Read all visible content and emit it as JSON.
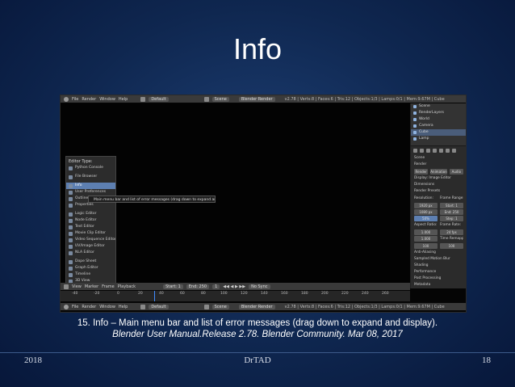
{
  "slide": {
    "title": "Info",
    "caption_line1": "15. Info – Main menu bar and list of error messages (drag down to expand and display).",
    "caption_line2": "Blender User Manual.Release 2.78. Blender Community. Mar 08, 2017",
    "footer_left": "2018",
    "footer_center": "DrTAD",
    "footer_right": "18"
  },
  "blender": {
    "top_bar": {
      "title": "Blender",
      "menus": [
        "File",
        "Render",
        "Window",
        "Help"
      ],
      "layout": "Default",
      "scene": "Scene",
      "engine": "Blender Render",
      "stats": "v2.78 | Verts:8 | Faces:6 | Tris:12 | Objects:1/3 | Lamps:0/1 | Mem:9.67M | Cube"
    },
    "editor_menu": {
      "header": "Editor Type:",
      "items": [
        "Python Console",
        "File Browser",
        "Info",
        "User Preferences",
        "Outliner",
        "Properties",
        "Logic Editor",
        "Node Editor",
        "Text Editor",
        "Movie Clip Editor",
        "Video Sequence Editor",
        "UV/Image Editor",
        "NLA Editor",
        "Dope Sheet",
        "Graph Editor",
        "Timeline",
        "3D View"
      ]
    },
    "tooltip": "Main menu bar and list of error messages (drag down to expand and display)",
    "outliner": {
      "items": [
        "Scene",
        "RenderLayers",
        "World",
        "Camera",
        "Cube",
        "Lamp"
      ]
    },
    "properties": {
      "breadcrumb": "Scene",
      "render_label": "Render",
      "render_btn": "Render",
      "animation_btn": "Animation",
      "audio_btn": "Audio",
      "display_label": "Display:",
      "display_value": "Image Editor",
      "dimensions_label": "Dimensions",
      "presets_label": "Render Presets",
      "resolution_label": "Resolution:",
      "frame_range_label": "Frame Range:",
      "res_x": "1920 px",
      "res_y": "1080 px",
      "res_pct": "50%",
      "start": "Start: 1",
      "end": "End: 250",
      "step": "Step: 1",
      "aspect_label": "Aspect Ratio:",
      "frame_rate_label": "Frame Rate:",
      "aspect_x": "1.000",
      "aspect_y": "1.000",
      "fps": "24 fps",
      "time_stretch": "Time Remapping:",
      "old": "100",
      "new": "100",
      "anti_aliasing": "Anti-Aliasing",
      "sampled_motion": "Sampled Motion Blur",
      "shading": "Shading",
      "performance": "Performance",
      "post_processing": "Post Processing",
      "metadata": "Metadata"
    },
    "timeline_bar": {
      "menus": [
        "View",
        "Marker",
        "Frame",
        "Playback"
      ],
      "start": "Start: 1",
      "end": "End: 250",
      "current": "1",
      "sync": "No Sync"
    },
    "timeline_numbers": [
      "-40",
      "-20",
      "0",
      "20",
      "40",
      "60",
      "80",
      "100",
      "120",
      "140",
      "160",
      "180",
      "200",
      "220",
      "240",
      "260"
    ],
    "bottom_bar": {
      "menus": [
        "File",
        "Render",
        "Window",
        "Help"
      ],
      "layout": "Default",
      "scene": "Scene",
      "engine": "Blender Render",
      "stats": "v2.78 | Verts:8 | Faces:6 | Tris:12 | Objects:1/3 | Lamps:0/1 | Mem:9.67M | Cube"
    }
  }
}
